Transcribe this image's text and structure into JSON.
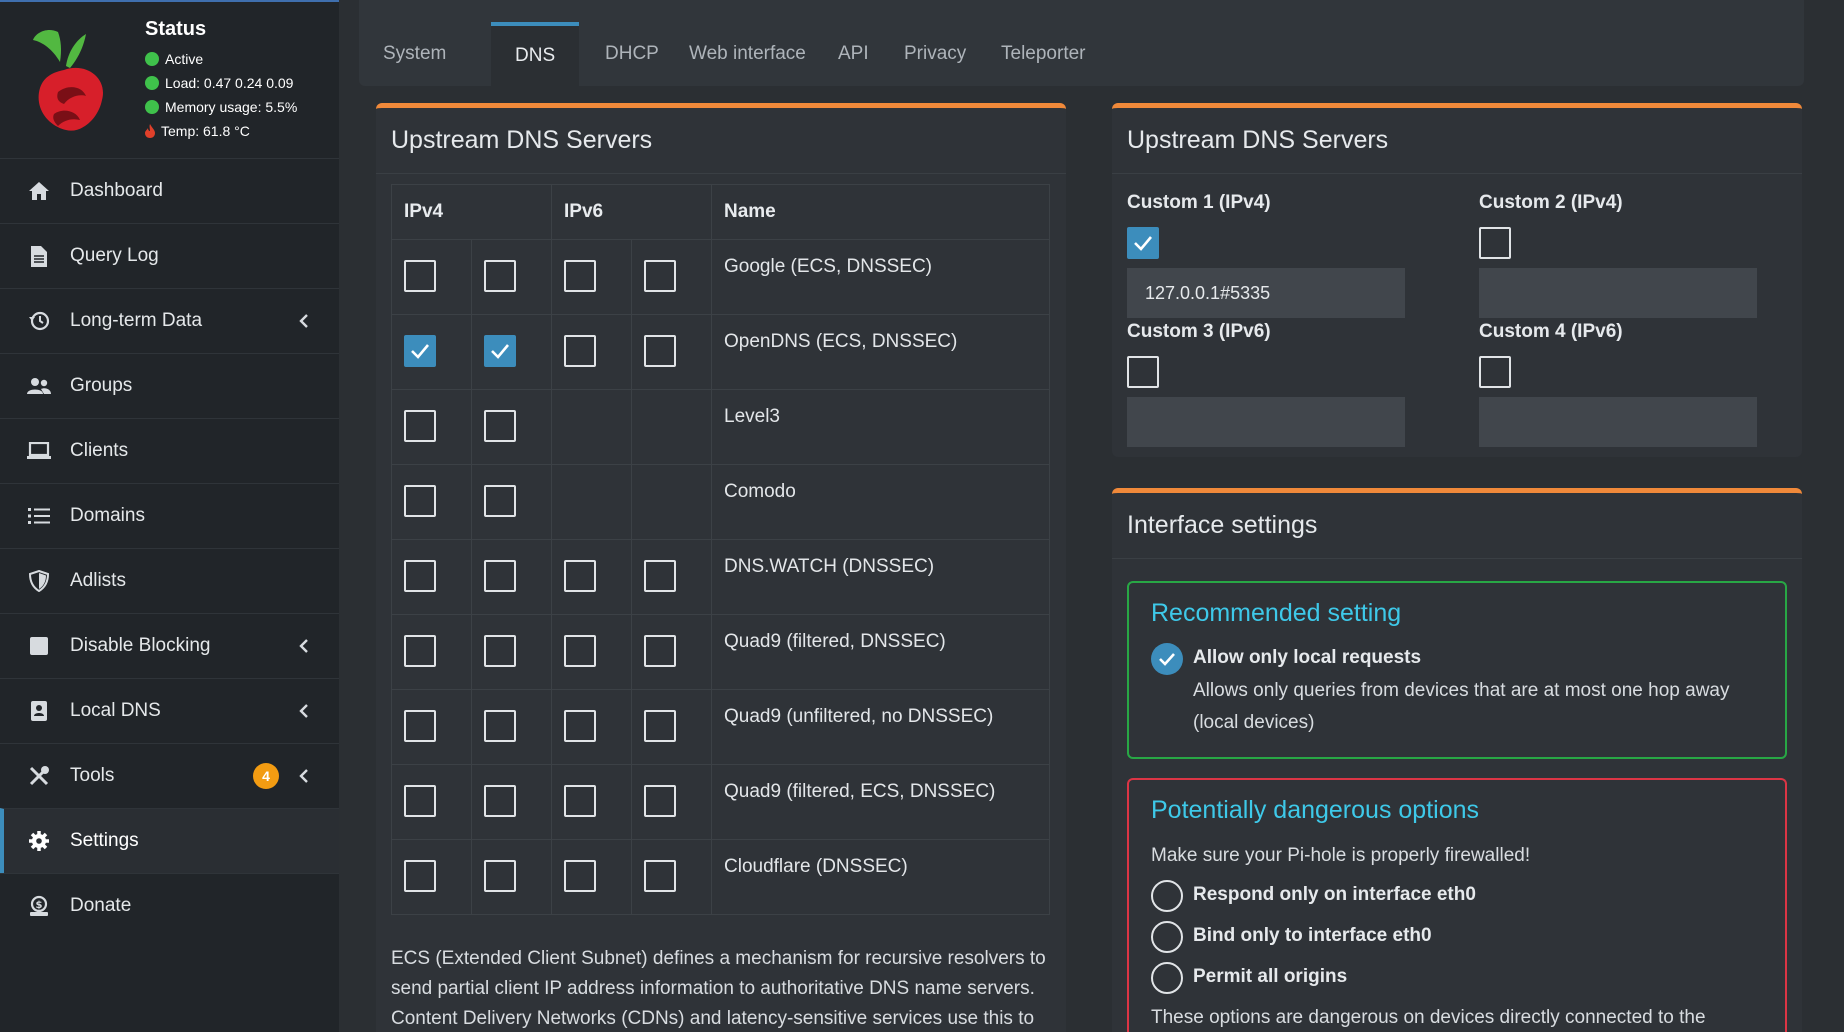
{
  "status": {
    "title": "Status",
    "active": "Active",
    "load": "Load:  0.47  0.24  0.09",
    "memory": "Memory usage:  5.5%",
    "temp": "Temp: 61.8 °C"
  },
  "nav": {
    "items": [
      {
        "label": "Dashboard"
      },
      {
        "label": "Query Log"
      },
      {
        "label": "Long-term Data"
      },
      {
        "label": "Groups"
      },
      {
        "label": "Clients"
      },
      {
        "label": "Domains"
      },
      {
        "label": "Adlists"
      },
      {
        "label": "Disable Blocking"
      },
      {
        "label": "Local DNS"
      },
      {
        "label": "Tools",
        "badge": "4"
      },
      {
        "label": "Settings"
      },
      {
        "label": "Donate"
      }
    ]
  },
  "tabs": [
    {
      "label": "System"
    },
    {
      "label": "DNS"
    },
    {
      "label": "DHCP"
    },
    {
      "label": "Web interface"
    },
    {
      "label": "API"
    },
    {
      "label": "Privacy"
    },
    {
      "label": "Teleporter"
    }
  ],
  "upstream": {
    "title": "Upstream DNS Servers",
    "headers": {
      "ipv4": "IPv4",
      "ipv6": "IPv6",
      "name": "Name"
    },
    "rows": [
      {
        "name": "Google (ECS, DNSSEC)",
        "checks": [
          false,
          false,
          false,
          false
        ]
      },
      {
        "name": "OpenDNS (ECS, DNSSEC)",
        "checks": [
          true,
          true,
          false,
          false
        ]
      },
      {
        "name": "Level3",
        "checks": [
          false,
          false,
          null,
          null
        ]
      },
      {
        "name": "Comodo",
        "checks": [
          false,
          false,
          null,
          null
        ]
      },
      {
        "name": "DNS.WATCH (DNSSEC)",
        "checks": [
          false,
          false,
          false,
          false
        ]
      },
      {
        "name": "Quad9 (filtered, DNSSEC)",
        "checks": [
          false,
          false,
          false,
          false
        ]
      },
      {
        "name": "Quad9 (unfiltered, no DNSSEC)",
        "checks": [
          false,
          false,
          false,
          false
        ]
      },
      {
        "name": "Quad9 (filtered, ECS, DNSSEC)",
        "checks": [
          false,
          false,
          false,
          false
        ]
      },
      {
        "name": "Cloudflare (DNSSEC)",
        "checks": [
          false,
          false,
          false,
          false
        ]
      }
    ],
    "ecs_text": "ECS (Extended Client Subnet) defines a mechanism for recursive resolvers to send partial client IP address information to authoritative DNS name servers. Content Delivery Networks (CDNs) and latency-sensitive services use this to"
  },
  "custom": {
    "title": "Upstream DNS Servers",
    "c1_label": "Custom 1 (IPv4)",
    "c1_value": "127.0.0.1#5335",
    "c2_label": "Custom 2 (IPv4)",
    "c3_label": "Custom 3 (IPv6)",
    "c4_label": "Custom 4 (IPv6)"
  },
  "interface": {
    "title": "Interface settings",
    "recommended_title": "Recommended setting",
    "local_label": "Allow only local requests",
    "local_desc_1": "Allows only queries from devices that are at most one hop away",
    "local_desc_2": "(local devices)",
    "danger_title": "Potentially dangerous options",
    "danger_warning": "Make sure your Pi-hole is properly firewalled!",
    "opt1": "Respond only on interface eth0",
    "opt2": "Bind only to interface eth0",
    "opt3": "Permit all origins",
    "danger_footer": "These options are dangerous on devices directly connected to the"
  },
  "colors": {
    "accent": "#3c8dbc",
    "box_top": "#f0893a",
    "green": "#28a745",
    "red": "#dc3545",
    "cyan": "#3ec9e9"
  }
}
